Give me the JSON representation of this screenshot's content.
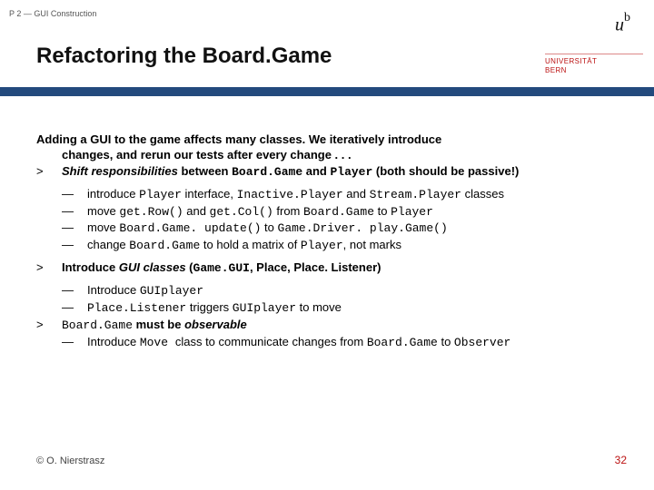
{
  "header": {
    "course": "P 2 — GUI Construction",
    "title": "Refactoring the Board.Game"
  },
  "logo": {
    "u": "u",
    "b": "b",
    "uni": "UNIVERSITÄT",
    "bern": "BERN"
  },
  "content": {
    "intro_l1": "Adding a GUI to the game affects many classes. We iteratively introduce",
    "intro_l2": "changes, and rerun our tests after every change . . .",
    "p1_mk": ">",
    "p1_a": "Shift responsibilities",
    "p1_b": " between ",
    "p1_c": "Board.Game",
    "p1_d": " and ",
    "p1_e": "Player",
    "p1_f": " (both should be passive!)",
    "s1_mk": "—",
    "s1_a": "introduce ",
    "s1_b": "Player",
    "s1_c": " interface, ",
    "s1_d": "Inactive.Player",
    "s1_e": " and ",
    "s1_f": "Stream.Player",
    "s1_g": " classes",
    "s2_mk": "—",
    "s2_a": "move ",
    "s2_b": "get.Row()",
    "s2_c": " and ",
    "s2_d": "get.Col()",
    "s2_e": " from ",
    "s2_f": "Board.Game",
    "s2_g": " to ",
    "s2_h": "Player",
    "s3_mk": "—",
    "s3_a": "move ",
    "s3_b": "Board.Game. update()",
    "s3_c": " to ",
    "s3_d": "Game.Driver. play.Game()",
    "s4_mk": "—",
    "s4_a": "change ",
    "s4_b": "Board.Game",
    "s4_c": " to hold a matrix of ",
    "s4_d": "Player",
    "s4_e": ", not marks",
    "p2_mk": ">",
    "p2_a": "Introduce ",
    "p2_b": "GUI classes",
    "p2_c": " (",
    "p2_d": "Game.GUI",
    "p2_e": ", Place, Place. Listener)",
    "s5_mk": "—",
    "s5_a": "Introduce ",
    "s5_b": "GUIplayer",
    "s6_mk": "—",
    "s6_a": "Place.Listener",
    "s6_b": " triggers ",
    "s6_c": "GUIplayer",
    "s6_d": " to move",
    "p3_mk": ">",
    "p3_a": "Board.Game",
    "p3_b": " must be ",
    "p3_c": "observable",
    "s7_mk": "—",
    "s7_a": "Introduce ",
    "s7_b": "Move ",
    "s7_c": "class to communicate changes from ",
    "s7_d": "Board.Game",
    "s7_e": " to ",
    "s7_f": "Observer"
  },
  "footer": {
    "copyright": "© O. Nierstrasz",
    "page": "32"
  }
}
